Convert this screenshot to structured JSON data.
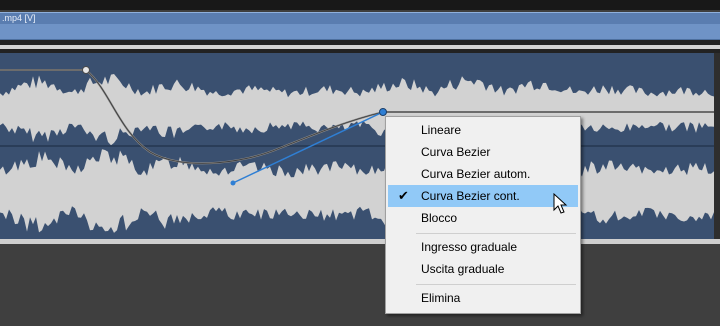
{
  "video_track": {
    "clip_label": ".mp4 [V]"
  },
  "context_menu": {
    "items": [
      {
        "label": "Lineare"
      },
      {
        "label": "Curva Bezier"
      },
      {
        "label": "Curva Bezier autom."
      },
      {
        "label": "Curva Bezier cont.",
        "checked": true
      },
      {
        "label": "Blocco"
      },
      {
        "label": "Ingresso graduale"
      },
      {
        "label": "Uscita graduale"
      },
      {
        "label": "Elimina"
      }
    ]
  },
  "colors": {
    "waveform": "#d2d2d2",
    "audio_track_bg": "#3a5070",
    "video_track": "#6f93c6",
    "menu_highlight": "#91c9f7",
    "bezier_handle": "#2f7fd4"
  },
  "icons": {
    "checkmark": "check-icon",
    "mouse_pointer": "cursor-icon"
  }
}
